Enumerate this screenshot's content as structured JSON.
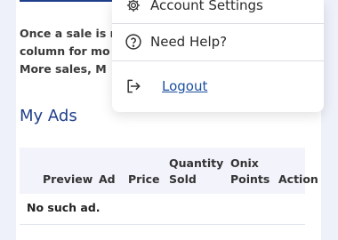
{
  "info": {
    "line1": "Once a sale is m",
    "line2": "column for mo",
    "line3": "More sales, M"
  },
  "my_ads": {
    "title": "My Ads",
    "columns": {
      "preview": "Preview",
      "ad": "Ad",
      "price": "Price",
      "quantity_line1": "Quantity",
      "quantity_line2": "Sold",
      "onix_line1": "Onix",
      "onix_line2": "Points",
      "action": "Action"
    },
    "empty_message": "No such ad."
  },
  "user_menu": {
    "items": [
      {
        "label": "Account Settings",
        "icon": "gear-icon"
      },
      {
        "label": "Need Help?",
        "icon": "help-circle-icon"
      },
      {
        "label": "Logout",
        "icon": "logout-icon"
      }
    ]
  },
  "colors": {
    "accent": "#1f3f8a",
    "link": "#1c4fa0",
    "page_bg": "#eef0fa",
    "table_head_bg": "#f3f4fb"
  }
}
